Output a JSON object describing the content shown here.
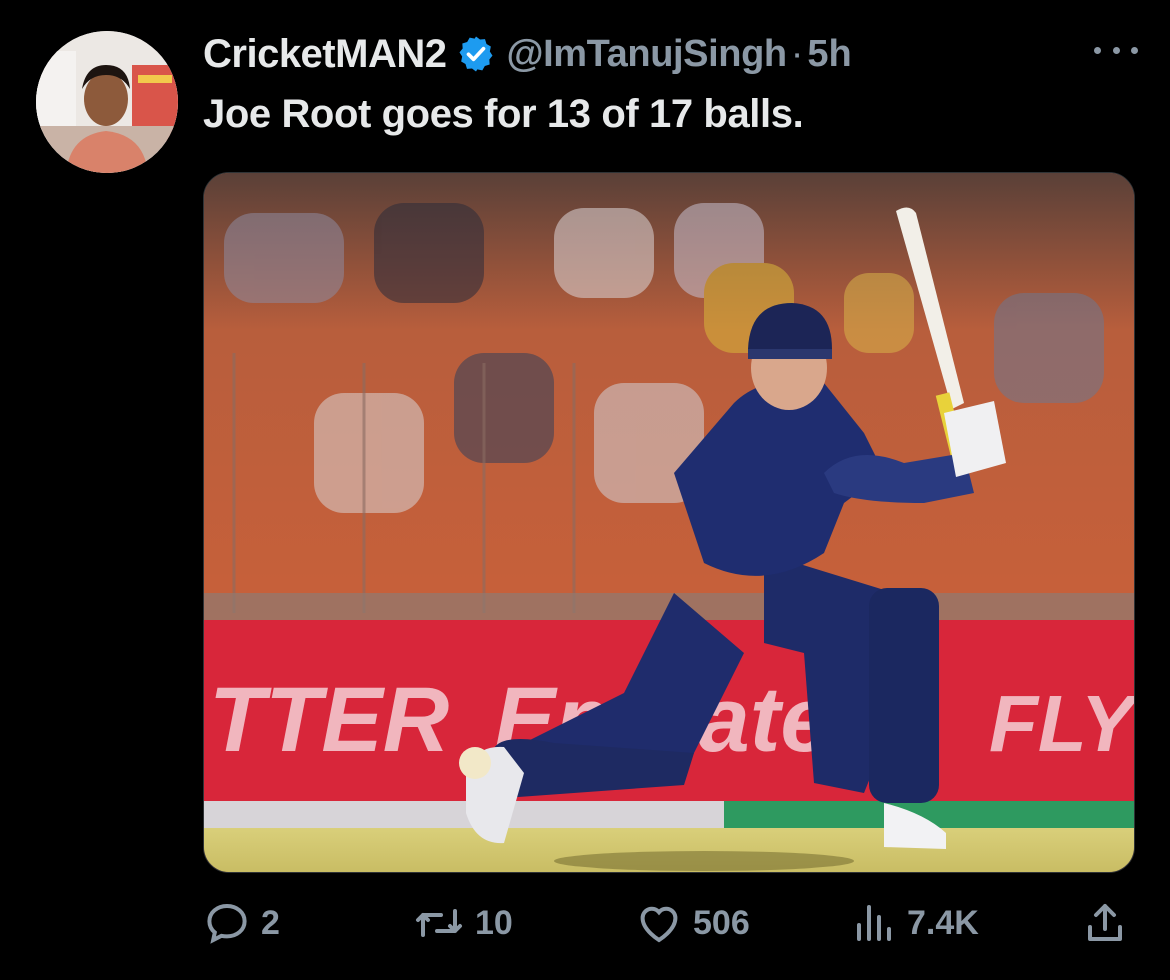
{
  "tweet": {
    "display_name": "CricketMAN2",
    "handle": "@ImTanujSingh",
    "separator": "·",
    "time": "5h",
    "text": "Joe Root goes for 13 of 17 balls.",
    "media": {
      "banner_left": "TTER",
      "banner_mid": "Emirates",
      "banner_right": "FLY"
    }
  },
  "actions": {
    "replies": "2",
    "retweets": "10",
    "likes": "506",
    "views": "7.4K"
  },
  "colors": {
    "background": "#000000",
    "text_primary": "#e7e9ea",
    "text_secondary": "#8b98a5",
    "verified": "#1d9bf0",
    "ad_board": "#d8263a"
  },
  "icons": [
    "verified-badge-icon",
    "more-icon",
    "reply-icon",
    "retweet-icon",
    "like-icon",
    "views-icon",
    "share-icon"
  ]
}
